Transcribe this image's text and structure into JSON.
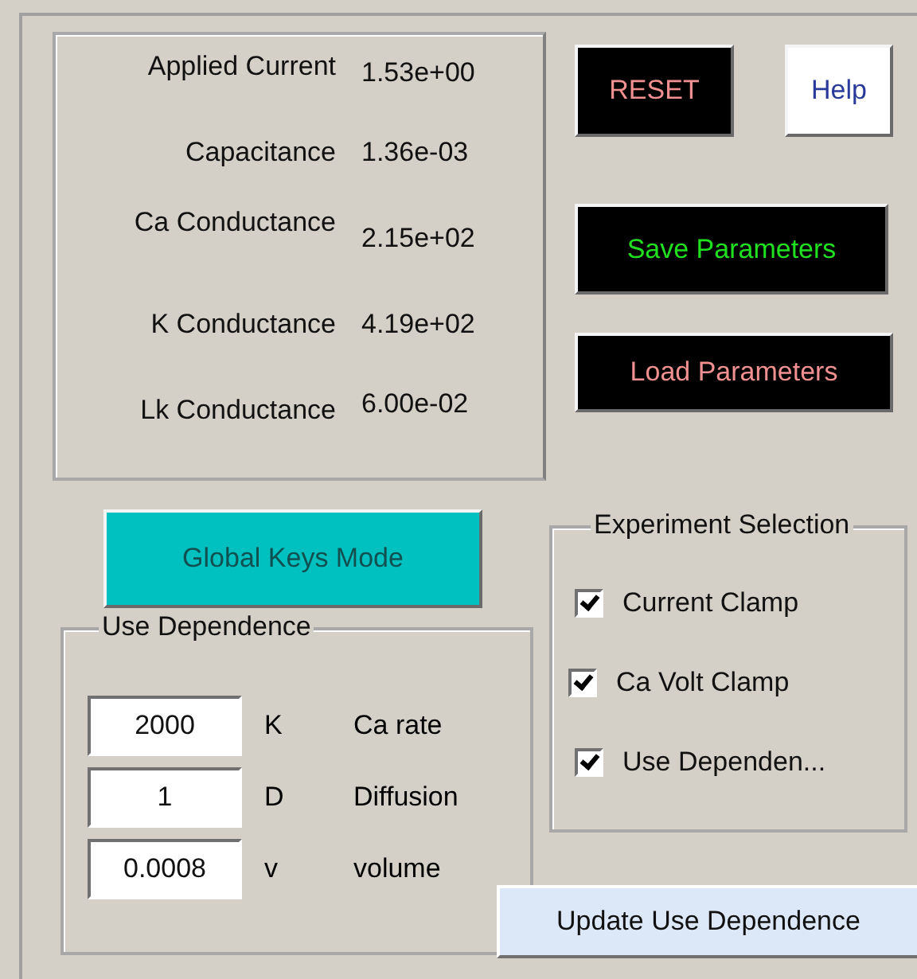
{
  "parameters": [
    {
      "label": "Applied Current",
      "value": "1.53e+00"
    },
    {
      "label": "Capacitance",
      "value": "1.36e-03"
    },
    {
      "label": "Ca Conductance",
      "value": "2.15e+02"
    },
    {
      "label": "K Conductance",
      "value": "4.19e+02"
    },
    {
      "label": "Lk Conductance",
      "value": "6.00e-02"
    }
  ],
  "buttons": {
    "reset": "RESET",
    "help": "Help",
    "save": "Save Parameters",
    "load": "Load Parameters",
    "global_keys": "Global Keys Mode",
    "update": "Update Use Dependence"
  },
  "use_dependence": {
    "title": "Use Dependence",
    "fields": [
      {
        "value": "2000",
        "symbol": "K",
        "label": "Ca rate"
      },
      {
        "value": "1",
        "symbol": "D",
        "label": "Diffusion"
      },
      {
        "value": "0.0008",
        "symbol": "v",
        "label": "volume"
      }
    ]
  },
  "experiment_selection": {
    "title": "Experiment Selection",
    "options": [
      {
        "label": "Current Clamp",
        "checked": true
      },
      {
        "label": "Ca Volt Clamp",
        "checked": true
      },
      {
        "label": "Use Dependen...",
        "checked": true
      }
    ]
  }
}
